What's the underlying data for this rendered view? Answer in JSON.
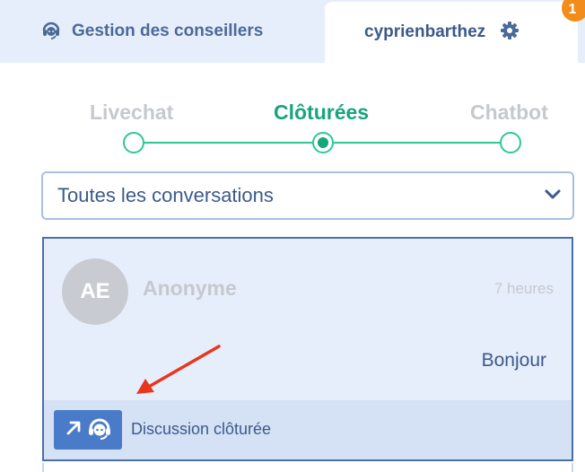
{
  "tabs": {
    "left_label": "Gestion des conseillers",
    "right_label": "cyprienbarthez",
    "notification_count": "1"
  },
  "stepper": {
    "steps": [
      "Livechat",
      "Clôturées",
      "Chatbot"
    ],
    "active_index": 1
  },
  "filter": {
    "selected": "Toutes les conversations"
  },
  "conversation": {
    "initials": "AE",
    "name": "Anonyme",
    "time": "7 heures",
    "message": "Bonjour",
    "status": "Discussion clôturée"
  },
  "colors": {
    "accent_green": "#17a57c",
    "line_green": "#2ec796",
    "primary_blue": "#4a7bc8",
    "badge_orange": "#f28c1a",
    "arrow_red": "#e8361e"
  },
  "icons": {
    "tab_left": "headset-icon",
    "tab_right": "gear-icon",
    "select": "chevron-down-icon",
    "status": "headset-reopen-icon"
  }
}
